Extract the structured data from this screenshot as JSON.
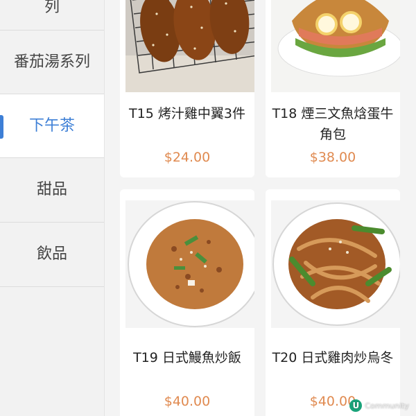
{
  "sidebar": {
    "items": [
      {
        "label": "列"
      },
      {
        "label": "番茄湯系列"
      },
      {
        "label": "下午茶",
        "selected": true
      },
      {
        "label": "甜品"
      },
      {
        "label": "飲品"
      }
    ],
    "accent_color": "#3d7fd6"
  },
  "products": [
    {
      "title": "T15 烤汁雞中翼3件",
      "price": "$24.00",
      "image_icon": "chicken-wings-image"
    },
    {
      "title": "T18 煙三文魚焓蛋牛角包",
      "price": "$38.00",
      "image_icon": "salmon-croissant-image"
    },
    {
      "title": "T19 日式鰻魚炒飯",
      "price": "$40.00",
      "image_icon": "eel-fried-rice-image"
    },
    {
      "title": "T20 日式雞肉炒烏冬",
      "price": "$40.00",
      "image_icon": "chicken-udon-image"
    }
  ],
  "price_color": "#e08a50",
  "watermark": {
    "text": "Community"
  }
}
